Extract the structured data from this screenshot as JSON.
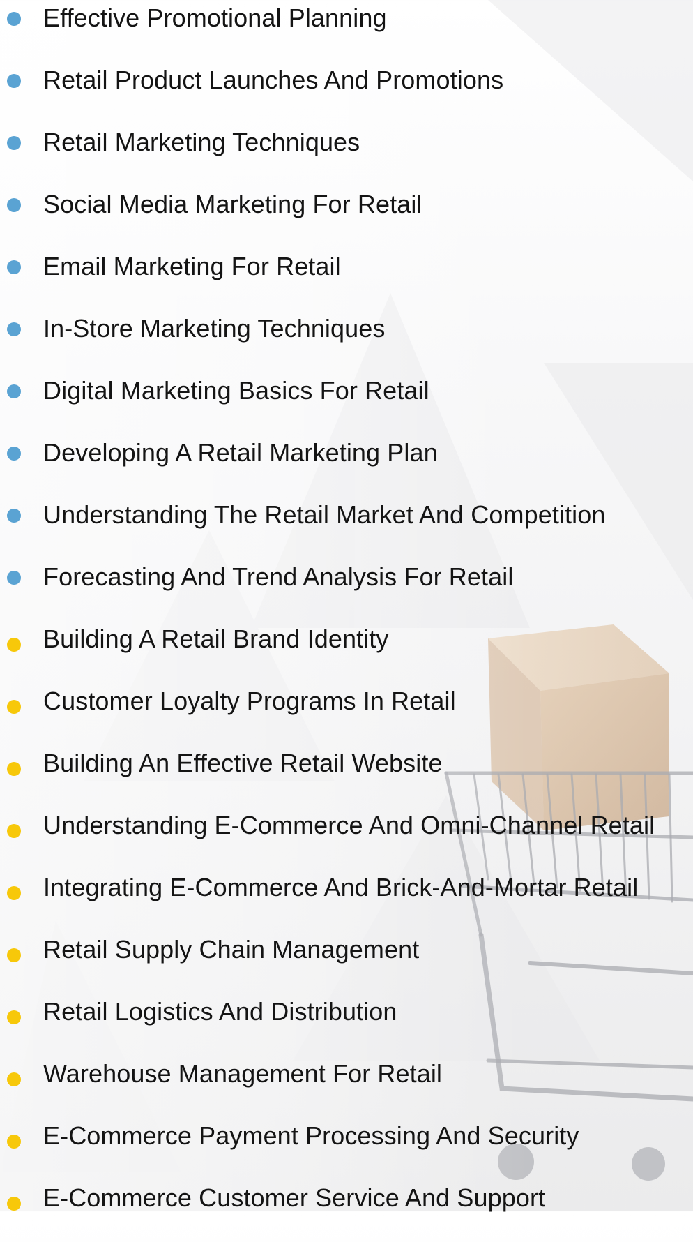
{
  "topics": [
    {
      "label": "Effective Promotional Planning",
      "bullet_color": "#5aa3d3"
    },
    {
      "label": "Retail Product Launches And Promotions",
      "bullet_color": "#5aa3d3"
    },
    {
      "label": "Retail Marketing Techniques",
      "bullet_color": "#5aa3d3"
    },
    {
      "label": "Social Media Marketing For Retail",
      "bullet_color": "#5aa3d3"
    },
    {
      "label": "Email Marketing For Retail",
      "bullet_color": "#5aa3d3"
    },
    {
      "label": "In-Store Marketing Techniques",
      "bullet_color": "#5aa3d3"
    },
    {
      "label": "Digital Marketing Basics For Retail",
      "bullet_color": "#5aa3d3"
    },
    {
      "label": "Developing A Retail Marketing Plan",
      "bullet_color": "#5aa3d3"
    },
    {
      "label": "Understanding The Retail Market And Competition",
      "bullet_color": "#5aa3d3"
    },
    {
      "label": "Forecasting And Trend Analysis For Retail",
      "bullet_color": "#5aa3d3"
    },
    {
      "label": "Building A Retail Brand Identity",
      "bullet_color": "#f7c80a"
    },
    {
      "label": "Customer Loyalty Programs In Retail",
      "bullet_color": "#f7c80a"
    },
    {
      "label": "Building An Effective Retail Website",
      "bullet_color": "#f7c80a"
    },
    {
      "label": "Understanding E-Commerce And Omni-Channel Retail",
      "bullet_color": "#f7c80a"
    },
    {
      "label": "Integrating E-Commerce And Brick-And-Mortar Retail",
      "bullet_color": "#f7c80a"
    },
    {
      "label": "Retail Supply Chain Management",
      "bullet_color": "#f7c80a"
    },
    {
      "label": "Retail Logistics And Distribution",
      "bullet_color": "#f7c80a"
    },
    {
      "label": "Warehouse Management For Retail",
      "bullet_color": "#f7c80a"
    },
    {
      "label": "E-Commerce Payment Processing And Security",
      "bullet_color": "#f7c80a"
    },
    {
      "label": "E-Commerce Customer Service And Support",
      "bullet_color": "#f7c80a"
    }
  ]
}
